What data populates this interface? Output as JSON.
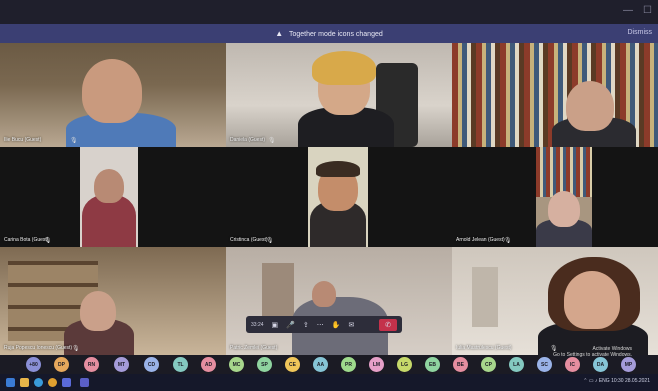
{
  "banner": {
    "message": "Together mode icons changed",
    "dismiss": "Dismiss"
  },
  "tiles": [
    {
      "name": "Ilie Bucu (Guest)"
    },
    {
      "name": "Daniela (Guest)"
    },
    {
      "name": ""
    },
    {
      "name": "Carina Bota (Guest)"
    },
    {
      "name": "Cristinca (Guest)"
    },
    {
      "name": "Arnold Jelean (Guest)"
    },
    {
      "name": "Ruja Popescu Ionescu (Guest)"
    },
    {
      "name": "Patric Zemlei (Guest)"
    },
    {
      "name": "Iulia Mastrulescu (Guest)"
    }
  ],
  "controls": {
    "timer": "33:24"
  },
  "avatars": [
    {
      "initials": "+80",
      "color": "#8a8fd6"
    },
    {
      "initials": "DP",
      "color": "#e6a85c"
    },
    {
      "initials": "RN",
      "color": "#e58ea0"
    },
    {
      "initials": "MT",
      "color": "#a59cd9"
    },
    {
      "initials": "CD",
      "color": "#9ab3e8"
    },
    {
      "initials": "TL",
      "color": "#84c9c0"
    },
    {
      "initials": "AD",
      "color": "#e58ea0"
    },
    {
      "initials": "MC",
      "color": "#a7d68c"
    },
    {
      "initials": "SP",
      "color": "#8fd4a0"
    },
    {
      "initials": "CE",
      "color": "#f0c65a"
    },
    {
      "initials": "AA",
      "color": "#86c5d6"
    },
    {
      "initials": "PR",
      "color": "#9edb8c"
    },
    {
      "initials": "LM",
      "color": "#e6a0c8"
    },
    {
      "initials": "LG",
      "color": "#c6d96a"
    },
    {
      "initials": "EB",
      "color": "#8fd4a0"
    },
    {
      "initials": "BE",
      "color": "#e58ea0"
    },
    {
      "initials": "CP",
      "color": "#a7d68c"
    },
    {
      "initials": "LA",
      "color": "#84c9c0"
    },
    {
      "initials": "SC",
      "color": "#9ab3e8"
    },
    {
      "initials": "IC",
      "color": "#e58ea0"
    },
    {
      "initials": "DA",
      "color": "#86c5d6"
    },
    {
      "initials": "MP",
      "color": "#a59cd9"
    }
  ],
  "watermark": {
    "line1": "Activate Windows",
    "line2": "Go to Settings to activate Windows."
  },
  "tray": {
    "lang": "ENG",
    "time": "10:30",
    "date": "28.05.2021"
  }
}
